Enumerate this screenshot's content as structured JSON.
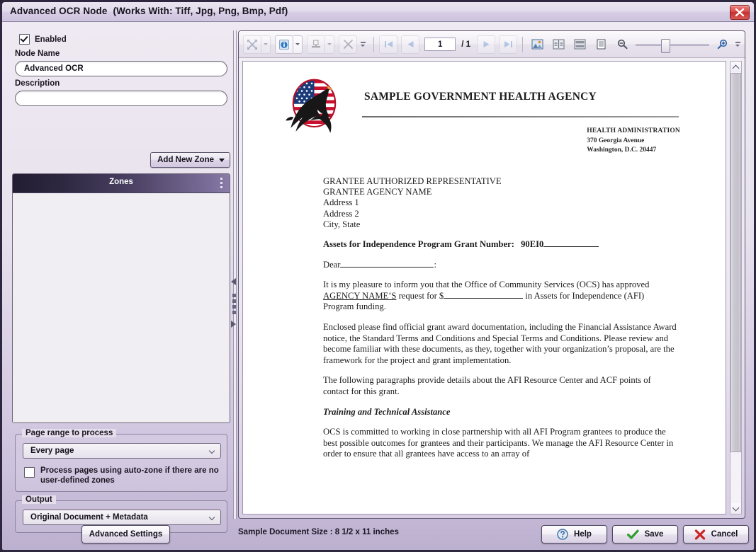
{
  "window": {
    "title": "Advanced OCR Node",
    "title_suffix": "(Works With: Tiff, Jpg, Png, Bmp, Pdf)",
    "close_icon": "close-icon"
  },
  "left_panel": {
    "enabled_checkbox": {
      "label": "Enabled",
      "checked": true
    },
    "node_name": {
      "label": "Node Name",
      "value": "Advanced OCR",
      "placeholder": ""
    },
    "description": {
      "label": "Description",
      "value": "",
      "placeholder": ""
    },
    "add_new_zone": {
      "label": "Add New Zone",
      "icon": "chevron-down-icon"
    },
    "zones_panel": {
      "title": "Zones",
      "menu_icon": "kebab-menu-icon",
      "items": []
    },
    "page_range_group": {
      "title": "Page range to process",
      "selected": "Every page",
      "options": [
        "Every page"
      ],
      "auto_zone_checkbox": {
        "label_line1": "Process pages using auto-zone if there are no",
        "label_line2": "user-defined zones",
        "checked": false
      }
    },
    "output_group": {
      "title": "Output",
      "selected": "Original Document + Metadata",
      "options": [
        "Original Document + Metadata"
      ]
    }
  },
  "viewer": {
    "toolbar": {
      "buttons": [
        {
          "name": "pan-tool-button",
          "icon": "arrows-diagonal-icon",
          "has_dropdown": true,
          "disabled": true
        },
        {
          "name": "annotation-info-button",
          "icon": "info-circle-icon",
          "has_dropdown": true,
          "disabled": false
        },
        {
          "name": "stamp-tool-button",
          "icon": "stamp-icon",
          "has_dropdown": true,
          "disabled": true
        },
        {
          "name": "delete-annotation-button",
          "icon": "close-x-icon",
          "has_dropdown": false,
          "disabled": true
        }
      ],
      "overflow_icon": "toolbar-overflow-icon",
      "first_page_button": {
        "icon": "first-page-icon",
        "disabled": true
      },
      "prev_page_button": {
        "icon": "previous-page-icon",
        "disabled": true
      },
      "page_number": "1",
      "page_separator": "/",
      "page_count": "1",
      "next_page_button": {
        "icon": "next-page-icon",
        "disabled": true
      },
      "last_page_button": {
        "icon": "last-page-icon",
        "disabled": true
      },
      "view_buttons": [
        {
          "name": "fit-image-button",
          "icon": "image-icon"
        },
        {
          "name": "fit-page-button",
          "icon": "fit-page-icon"
        },
        {
          "name": "fit-width-button",
          "icon": "fit-width-icon"
        },
        {
          "name": "actual-size-button",
          "icon": "page-icon"
        }
      ],
      "zoom_out_button": {
        "icon": "zoom-out-icon"
      },
      "zoom_in_button": {
        "icon": "zoom-in-icon"
      },
      "zoom_slider_value": 40
    },
    "document": {
      "agency_title": "SAMPLE GOVERNMENT HEALTH AGENCY",
      "logo": "eagle-flag-seal-icon",
      "header_address": [
        "HEALTH ADMINISTRATION",
        "370 Georgia Avenue",
        "Washington, D.C. 20447"
      ],
      "recipient": [
        "GRANTEE AUTHORIZED REPRESENTATIVE",
        "GRANTEE AGENCY NAME",
        "Address 1",
        "Address 2",
        "City, State"
      ],
      "grant_line_label": "Assets for Independence Program Grant Number:",
      "grant_line_value": "90EI0",
      "salutation": "Dear",
      "salutation_end": ":",
      "para1_a": "It is my pleasure to inform you that the Office of Community Services (OCS) has approved ",
      "para1_agency": "AGENCY NAME’S",
      "para1_b": " request for $",
      "para1_c": " in Assets for Independence (AFI) Program funding.",
      "para2": "Enclosed please find official grant award documentation, including the Financial Assistance Award notice, the Standard Terms and Conditions and Special Terms and Conditions.  Please review and become familiar with these documents, as they, together with your organization’s proposal, are the framework for the project and grant implementation.",
      "para3": "The following paragraphs provide details about the AFI Resource Center and ACF points of contact for this grant.",
      "heading1": "Training and Technical Assistance",
      "para4": "OCS is committed to working in close partnership with all AFI Program grantees to produce the best possible outcomes for grantees and their participants.  We manage the AFI Resource Center in order to ensure that all grantees have access to an array of"
    }
  },
  "bottom": {
    "advanced_settings_label": "Advanced Settings",
    "status_text": "Sample Document Size : 8 1/2 x 11 inches",
    "help_label": "Help",
    "help_icon": "help-circle-icon",
    "save_label": "Save",
    "save_icon": "check-icon",
    "cancel_label": "Cancel",
    "cancel_icon": "x-icon"
  },
  "colors": {
    "window_bg": "#e5dfec",
    "accent_purple": "#7d6f9b",
    "zones_header_dark": "#221d31",
    "close_red": "#c62f2f",
    "save_green": "#2f9c2f",
    "cancel_red": "#cc2222"
  }
}
